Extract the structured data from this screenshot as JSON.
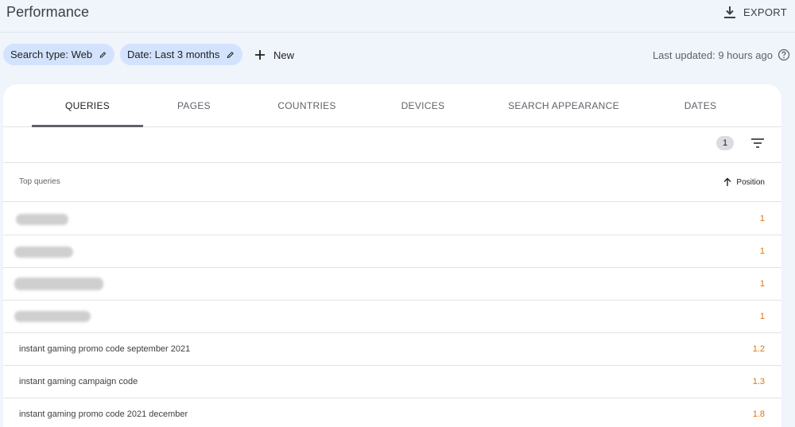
{
  "header": {
    "title": "Performance",
    "export_label": "EXPORT"
  },
  "filters": {
    "search_type_label": "Search type: Web",
    "date_label": "Date: Last 3 months",
    "new_label": "New",
    "last_updated": "Last updated: 9 hours ago"
  },
  "tabs": [
    {
      "label": "QUERIES",
      "active": true
    },
    {
      "label": "PAGES",
      "active": false
    },
    {
      "label": "COUNTRIES",
      "active": false
    },
    {
      "label": "DEVICES",
      "active": false
    },
    {
      "label": "SEARCH APPEARANCE",
      "active": false
    },
    {
      "label": "DATES",
      "active": false
    }
  ],
  "toolbar": {
    "active_filter_count": "1"
  },
  "table": {
    "query_header": "Top queries",
    "position_header": "Position",
    "rows": [
      {
        "query": "",
        "redacted": true,
        "position": "1"
      },
      {
        "query": "",
        "redacted": true,
        "position": "1"
      },
      {
        "query": "",
        "redacted": true,
        "position": "1"
      },
      {
        "query": "",
        "redacted": true,
        "position": "1"
      },
      {
        "query": "instant gaming promo code september 2021",
        "redacted": false,
        "position": "1.2"
      },
      {
        "query": "instant gaming campaign code",
        "redacted": false,
        "position": "1.3"
      },
      {
        "query": "instant gaming promo code 2021 december",
        "redacted": false,
        "position": "1.8"
      }
    ]
  },
  "colors": {
    "page_background": "#f0f4fb",
    "chip_background": "#d3e3fd",
    "position_value": "#e37400",
    "active_tab_indicator": "#5f6368"
  },
  "icons": {
    "export": "download-icon",
    "edit": "pencil-icon",
    "new": "plus-icon",
    "help": "help-circle-icon",
    "filter": "filter-lines-icon",
    "sort": "arrow-up-icon"
  }
}
